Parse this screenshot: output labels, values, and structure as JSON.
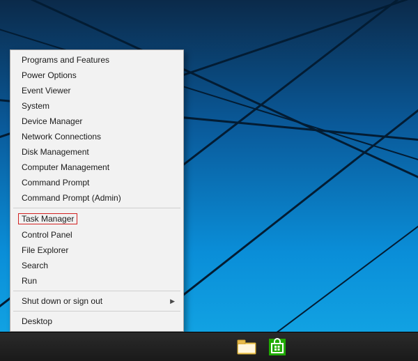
{
  "context_menu": {
    "groups": [
      {
        "items": [
          {
            "id": "programs-features",
            "label": "Programs and Features"
          },
          {
            "id": "power-options",
            "label": "Power Options"
          },
          {
            "id": "event-viewer",
            "label": "Event Viewer"
          },
          {
            "id": "system",
            "label": "System"
          },
          {
            "id": "device-manager",
            "label": "Device Manager"
          },
          {
            "id": "network-connections",
            "label": "Network Connections"
          },
          {
            "id": "disk-management",
            "label": "Disk Management"
          },
          {
            "id": "computer-management",
            "label": "Computer Management"
          },
          {
            "id": "command-prompt",
            "label": "Command Prompt"
          },
          {
            "id": "command-prompt-admin",
            "label": "Command Prompt (Admin)"
          }
        ]
      },
      {
        "items": [
          {
            "id": "task-manager",
            "label": "Task Manager",
            "highlighted": true
          },
          {
            "id": "control-panel",
            "label": "Control Panel"
          },
          {
            "id": "file-explorer",
            "label": "File Explorer"
          },
          {
            "id": "search",
            "label": "Search"
          },
          {
            "id": "run",
            "label": "Run"
          }
        ]
      },
      {
        "items": [
          {
            "id": "shut-down-sign-out",
            "label": "Shut down or sign out",
            "submenu": true
          }
        ]
      },
      {
        "items": [
          {
            "id": "desktop",
            "label": "Desktop"
          }
        ]
      }
    ]
  },
  "taskbar": {
    "items": [
      {
        "id": "file-explorer-task",
        "icon": "folder-icon"
      },
      {
        "id": "store-task",
        "icon": "store-icon"
      }
    ]
  }
}
